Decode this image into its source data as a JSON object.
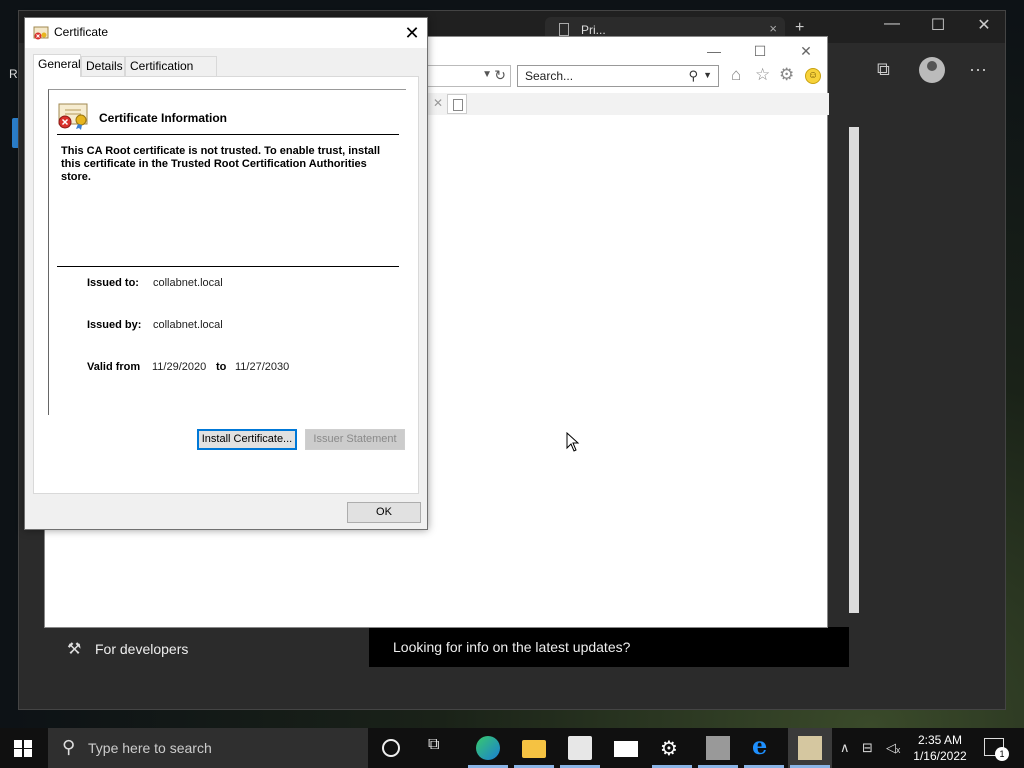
{
  "edge": {
    "tab_title": "Pri...",
    "side_item": "For developers",
    "banner": "Looking for info on the latest updates?",
    "partial_letter": "R"
  },
  "ie": {
    "search_placeholder": "Search..."
  },
  "certificate_dialog": {
    "title": "Certificate",
    "tabs": [
      "General",
      "Details",
      "Certification Path"
    ],
    "active_tab": "General",
    "heading": "Certificate Information",
    "warning": "This CA Root certificate is not trusted. To enable trust, install this certificate in the Trusted Root Certification Authorities store.",
    "issued_to_label": "Issued to:",
    "issued_to": "collabnet.local",
    "issued_by_label": "Issued by:",
    "issued_by": "collabnet.local",
    "valid_from_label": "Valid from",
    "valid_from": "11/29/2020",
    "to_label": "to",
    "valid_to": "11/27/2030",
    "install_button": "Install Certificate...",
    "issuer_button": "Issuer Statement",
    "ok_button": "OK"
  },
  "taskbar": {
    "search_placeholder": "Type here to search",
    "time": "2:35 AM",
    "date": "1/16/2022",
    "notification_count": "1"
  },
  "colors": {
    "accent": "#0078d7",
    "taskbar": "#101010",
    "dialog_bg": "#f0f0f0"
  }
}
